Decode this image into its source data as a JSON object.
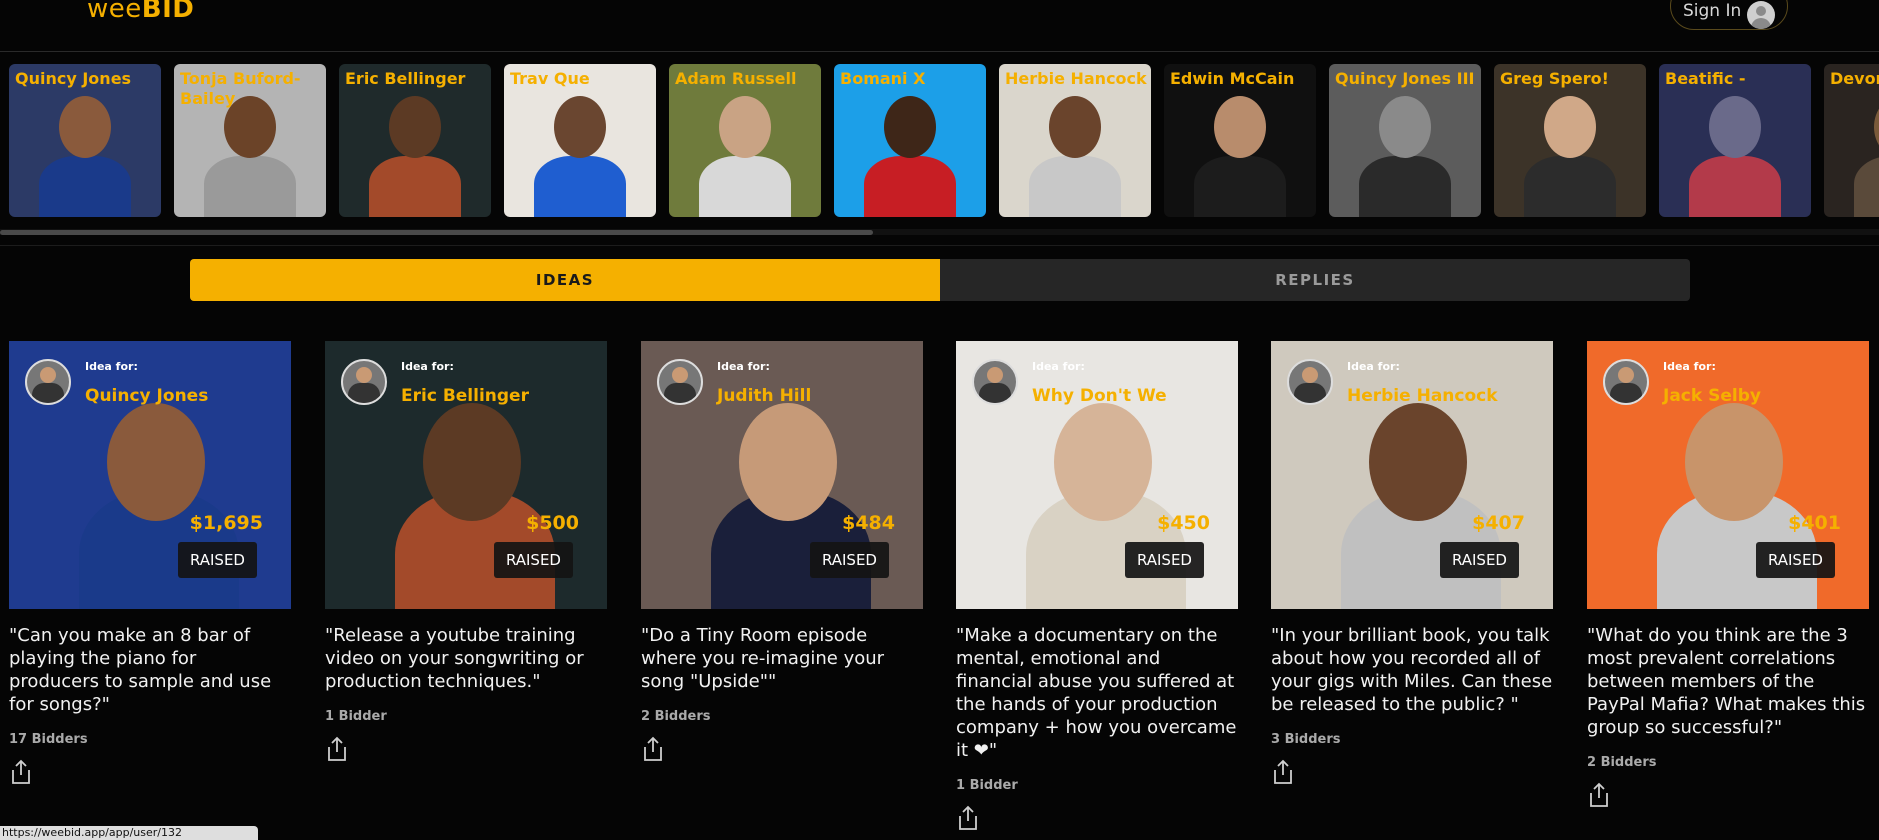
{
  "header": {
    "logo_wee": "wee",
    "logo_bid": "BID",
    "signin_label": "Sign In",
    "accent": "#f5b000"
  },
  "carousel": [
    {
      "name": "Quincy Jones",
      "bg": "#2c3a66",
      "skin": "#8a5a3c",
      "shirt": "#1a3a8a"
    },
    {
      "name": "Tonja Buford-Bailey",
      "bg": "#b4b4b4",
      "skin": "#6b4328",
      "shirt": "#9a9a9a"
    },
    {
      "name": "Eric Bellinger",
      "bg": "#1f2a2b",
      "skin": "#5c3a24",
      "shirt": "#a34a2a"
    },
    {
      "name": "Trav Que",
      "bg": "#e9e5df",
      "skin": "#6a4630",
      "shirt": "#1f5ed0"
    },
    {
      "name": "Adam Russell",
      "bg": "#6f7b3c",
      "skin": "#c9a384",
      "shirt": "#d8d8d8"
    },
    {
      "name": "Bomani X",
      "bg": "#1c9fe8",
      "skin": "#3e2618",
      "shirt": "#c71e24"
    },
    {
      "name": "Herbie Hancock",
      "bg": "#dad6cc",
      "skin": "#6a442c",
      "shirt": "#c8c8c8"
    },
    {
      "name": "Edwin McCain",
      "bg": "#101010",
      "skin": "#b88c6c",
      "shirt": "#1c1c1c"
    },
    {
      "name": "Quincy Jones III",
      "bg": "#5c5c5c",
      "skin": "#8a8a8a",
      "shirt": "#2a2a2a"
    },
    {
      "name": "Greg Spero!",
      "bg": "#3c3328",
      "skin": "#d0a888",
      "shirt": "#2c2c2c"
    },
    {
      "name": "Beatific -",
      "bg": "#2a2f55",
      "skin": "#6a6a8a",
      "shirt": "#b33a4a"
    },
    {
      "name": "Devon",
      "bg": "#2a2420",
      "skin": "#7a5a3a",
      "shirt": "#5a4a3a"
    }
  ],
  "tabs": [
    {
      "label": "IDEAS",
      "active": true
    },
    {
      "label": "REPLIES",
      "active": false
    }
  ],
  "ideas": [
    {
      "idea_for_label": "Idea for:",
      "name": "Quincy Jones",
      "amount": "$1,695",
      "raised_label": "RAISED",
      "text": "\"Can you make an 8 bar of playing the piano for producers to sample and use for songs?\"",
      "bidders": "17 Bidders",
      "bg": "#1f3b8f",
      "skin": "#8a5a3c",
      "shirt": "#1a3a8a"
    },
    {
      "idea_for_label": "Idea for:",
      "name": "Eric Bellinger",
      "amount": "$500",
      "raised_label": "RAISED",
      "text": "\"Release a youtube training video on your songwriting or production techniques.\"",
      "bidders": "1 Bidder",
      "bg": "#1d2a2c",
      "skin": "#5c3a24",
      "shirt": "#a34a2a"
    },
    {
      "idea_for_label": "Idea for:",
      "name": "Judith Hill",
      "amount": "$484",
      "raised_label": "RAISED",
      "text": "\"Do a Tiny Room episode where you re-imagine your song \"Upside\"\"",
      "bidders": "2 Bidders",
      "bg": "#6a5a54",
      "skin": "#c69a78",
      "shirt": "#1a1f3a"
    },
    {
      "idea_for_label": "Idea for:",
      "name": "Why Don't We",
      "amount": "$450",
      "raised_label": "RAISED",
      "text": "\"Make a documentary on the mental, emotional and financial abuse you suffered at the hands of your production company + how you overcame it ❤\"",
      "bidders": "1 Bidder",
      "bg": "#e8e6e2",
      "skin": "#d6b498",
      "shirt": "#d9d2c4"
    },
    {
      "idea_for_label": "Idea for:",
      "name": "Herbie Hancock",
      "amount": "$407",
      "raised_label": "RAISED",
      "text": "\"In your brilliant book, you talk about how you recorded all of your gigs with Miles. Can these be released to the public? \"",
      "bidders": "3 Bidders",
      "bg": "#cfc9be",
      "skin": "#6a442c",
      "shirt": "#c0c0c0"
    },
    {
      "idea_for_label": "Idea for:",
      "name": "Jack Selby",
      "amount": "$401",
      "raised_label": "RAISED",
      "text": "\"What do you think are the 3 most prevalent correlations between members of the PayPal Mafia? What makes this group so successful?\"",
      "bidders": "2 Bidders",
      "bg": "#f06a2a",
      "skin": "#c8946a",
      "shirt": "#c8c8c8"
    }
  ],
  "status_url": "https://weebid.app/app/user/132"
}
